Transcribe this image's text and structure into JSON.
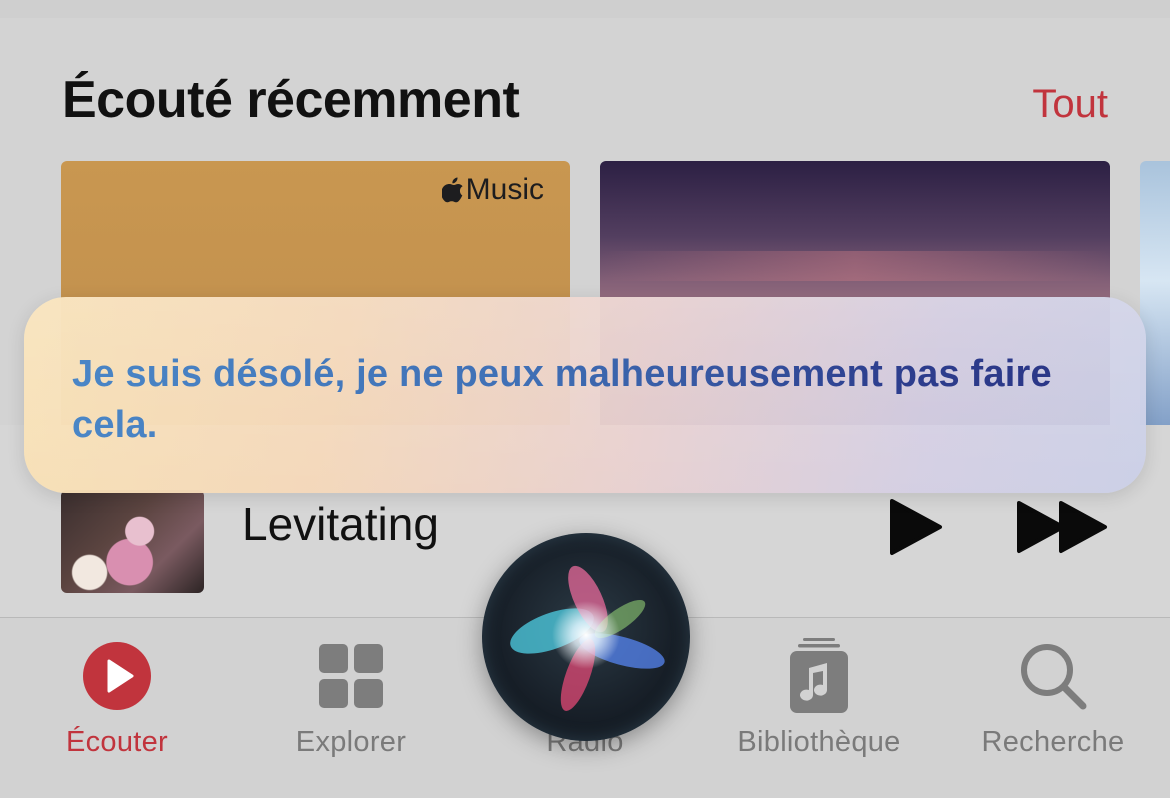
{
  "recent": {
    "title": "Écouté récemment",
    "see_all": "Tout",
    "card_badge": "Music"
  },
  "mini_player": {
    "track_title": "Levitating"
  },
  "siri": {
    "message": "Je suis désolé, je ne peux malheureusement pas faire cela."
  },
  "tabs": [
    {
      "label": "Écouter",
      "icon": "play-circle-icon",
      "active": true
    },
    {
      "label": "Explorer",
      "icon": "grid-icon",
      "active": false
    },
    {
      "label": "Radio",
      "icon": "radio-icon",
      "active": false
    },
    {
      "label": "Bibliothèque",
      "icon": "music-library-icon",
      "active": false
    },
    {
      "label": "Recherche",
      "icon": "search-icon",
      "active": false
    }
  ],
  "colors": {
    "accent": "#c1343d",
    "tab_inactive": "#7a7a7a",
    "siri_text_start": "#4a86c6",
    "siri_text_end": "#2a3585"
  }
}
